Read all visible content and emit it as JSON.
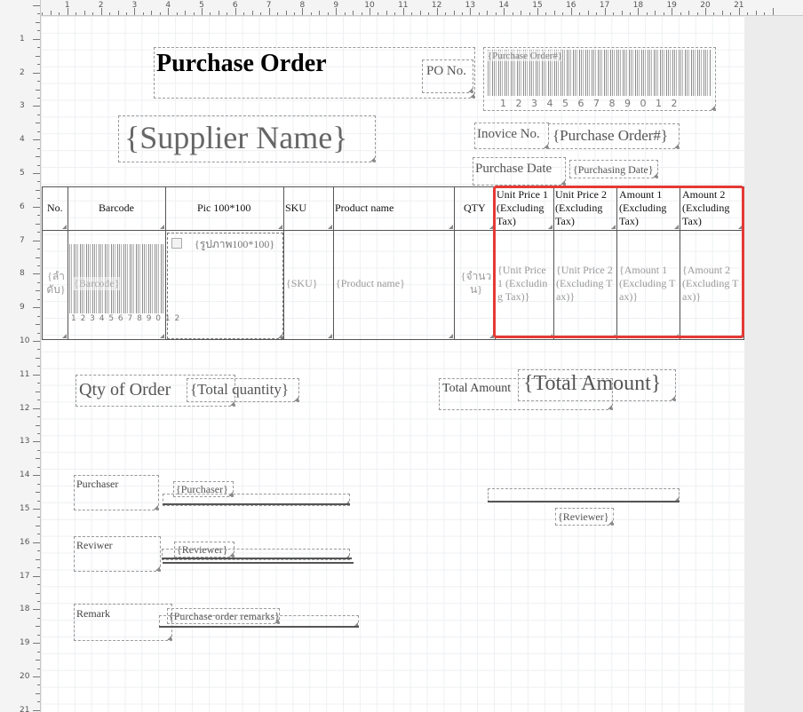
{
  "ruler": {
    "h_numbers": [
      "1",
      "2",
      "3",
      "4",
      "5",
      "6",
      "7",
      "8",
      "9",
      "10",
      "11",
      "12",
      "13",
      "14",
      "15",
      "16",
      "17",
      "18",
      "19",
      "20",
      "21"
    ],
    "v_numbers": [
      "1",
      "2",
      "3",
      "4",
      "5",
      "6",
      "7",
      "8",
      "9",
      "10",
      "11",
      "12",
      "13",
      "14",
      "15",
      "16",
      "17",
      "18",
      "19",
      "20",
      "21"
    ]
  },
  "header": {
    "title": "Purchase Order",
    "po_no_label": "PO No.",
    "po_barcode_field": "{Purchase Order#}",
    "po_barcode_digits": "1 2 3 4 5 6 7 8 9 0 1 2",
    "supplier_name": "{Supplier Name}",
    "invoice_no_label": "Inovice No.",
    "invoice_no_value": "{Purchase Order#}",
    "purchase_date_label": "Purchase Date",
    "purchase_date_value": "{Purchasing Date}"
  },
  "table": {
    "headers": {
      "no": "No.",
      "barcode": "Barcode",
      "pic": "Pic 100*100",
      "sku": "SKU",
      "product_name": "Product name",
      "qty": "QTY",
      "unit_price_1": [
        "Unit Price 1",
        "(Excluding",
        "Tax)"
      ],
      "unit_price_2": [
        "Unit Price 2",
        "(Excluding",
        "Tax)"
      ],
      "amount_1": [
        "Amount 1",
        "(Excluding",
        "Tax)"
      ],
      "amount_2": [
        "Amount 2",
        "(Excluding",
        "Tax)"
      ]
    },
    "row": {
      "no": [
        "{ลำ",
        "ดับ}"
      ],
      "barcode": "{Barcode}",
      "barcode_digits": "1 2 3 4 5 6 7 8 9 0 1 2",
      "pic": "{รูปภาพ100*100}",
      "sku": "{SKU}",
      "product_name": "{Product name}",
      "qty": [
        "{จำนว",
        "น}"
      ],
      "unit_price_1": [
        "{Unit Price",
        "1 (Excludin",
        "g Tax)}"
      ],
      "unit_price_2": [
        "{Unit Price 2",
        "(Excluding T",
        "ax)}"
      ],
      "amount_1": [
        "{Amount 1",
        "(Excluding T",
        "ax)}"
      ],
      "amount_2": [
        "{Amount 2",
        "(Excluding T",
        "ax)}"
      ]
    }
  },
  "totals": {
    "qty_label": "Qty of Order",
    "qty_value": "{Total quantity}",
    "amount_label": "Total Amount",
    "amount_value": "{Total Amount}"
  },
  "signatures": {
    "purchaser_label": "Purchaser",
    "purchaser_value": "{Purchaser}",
    "reviewer_label": "Reviwer",
    "reviewer_value": "{Reviewer}",
    "reviewer_right_value": "{Reviewer}",
    "remark_label": "Remark",
    "remark_value": "{Purchase order remarks}"
  },
  "colors": {
    "highlight": "#e53935",
    "page_background": "#ffffff",
    "field_text": "#666666"
  }
}
